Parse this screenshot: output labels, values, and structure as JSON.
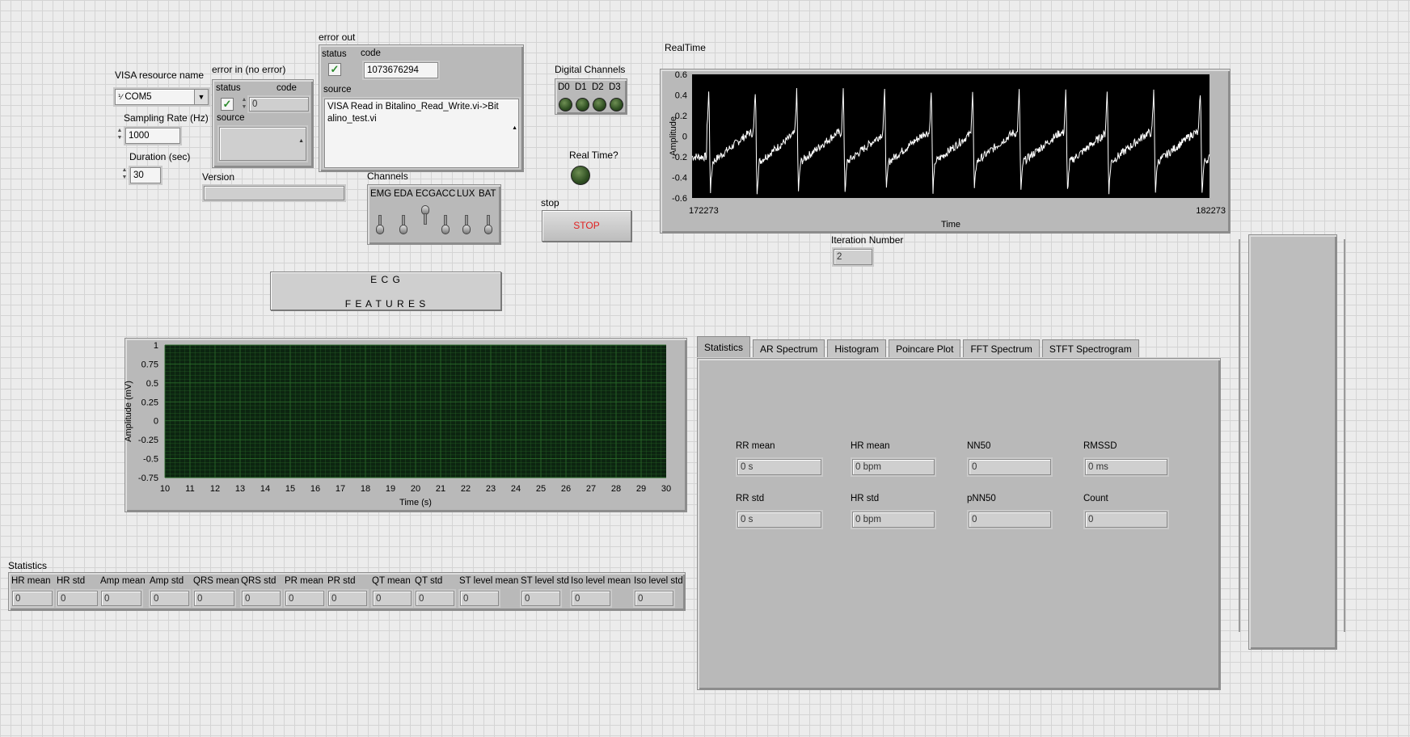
{
  "visa": {
    "label": "VISA resource name",
    "value": "COM5"
  },
  "sampling": {
    "label": "Sampling Rate (Hz)",
    "value": "1000"
  },
  "duration": {
    "label": "Duration (sec)",
    "value": "30"
  },
  "error_in": {
    "title": "error in (no error)",
    "status_label": "status",
    "code_label": "code",
    "code_value": "0",
    "source_label": "source"
  },
  "error_out": {
    "title": "error out",
    "status_label": "status",
    "code_label": "code",
    "code_value": "1073676294",
    "source_label": "source",
    "source_value": "VISA Read in Bitalino_Read_Write.vi->Bitalino_test.vi"
  },
  "version": {
    "label": "Version"
  },
  "digital": {
    "label": "Digital Channels",
    "channels": [
      "D0",
      "D1",
      "D2",
      "D3"
    ]
  },
  "realtime_toggle": {
    "label": "Real Time?"
  },
  "channels": {
    "label": "Channels",
    "names": [
      "EMG",
      "EDA",
      "ECG",
      "ACC",
      "LUX",
      "BAT"
    ]
  },
  "stop": {
    "label": "stop",
    "button": "STOP"
  },
  "ecg_features": {
    "line1": "E C G",
    "line2": "F E A T U R E S"
  },
  "iteration": {
    "label": "Iteration Number",
    "value": "2"
  },
  "realtime_graph": {
    "title": "RealTime",
    "x_start": "172273",
    "x_end": "182273",
    "xlabel": "Time",
    "ylabel": "Amplitude",
    "yticks": [
      "0.6",
      "0.4",
      "0.2",
      "0",
      "-0.2",
      "-0.4",
      "-0.6"
    ]
  },
  "ecg_graph": {
    "xlabel": "Time (s)",
    "ylabel": "Amplitude (mV)",
    "xticks": [
      "10",
      "11",
      "12",
      "13",
      "14",
      "15",
      "16",
      "17",
      "18",
      "19",
      "20",
      "21",
      "22",
      "23",
      "24",
      "25",
      "26",
      "27",
      "28",
      "29",
      "30"
    ],
    "yticks": [
      "1",
      "0.75",
      "0.5",
      "0.25",
      "0",
      "-0.25",
      "-0.5",
      "-0.75"
    ]
  },
  "tabs": [
    "Statistics",
    "AR Spectrum",
    "Histogram",
    "Poincare Plot",
    "FFT Spectrum",
    "STFT Spectrogram"
  ],
  "hrv": [
    {
      "label": "RR mean",
      "value": "0 s"
    },
    {
      "label": "HR mean",
      "value": "0 bpm"
    },
    {
      "label": "NN50",
      "value": "0"
    },
    {
      "label": "RMSSD",
      "value": "0 ms"
    },
    {
      "label": "RR std",
      "value": "0 s"
    },
    {
      "label": "HR std",
      "value": "0 bpm"
    },
    {
      "label": "pNN50",
      "value": "0"
    },
    {
      "label": "Count",
      "value": "0"
    }
  ],
  "statistics": {
    "title": "Statistics",
    "columns": [
      "HR mean",
      "HR std",
      "Amp mean",
      "Amp std",
      "QRS mean",
      "QRS std",
      "PR mean",
      "PR std",
      "QT mean",
      "QT std",
      "ST level mean",
      "ST level std",
      "Iso level mean",
      "Iso level std"
    ],
    "values": [
      "0",
      "0",
      "0",
      "0",
      "0",
      "0",
      "0",
      "0",
      "0",
      "0",
      "0",
      "0",
      "0",
      "0"
    ]
  },
  "colors": {
    "plot_bg": "#000000",
    "trace": "#ffffff",
    "ecg_bg": "#0c2410",
    "ecg_grid": "#2a6a2a",
    "stop_text": "#e02020"
  },
  "chart_data": {
    "type": "line",
    "title": "RealTime",
    "xlabel": "Time",
    "ylabel": "Amplitude",
    "xlim": [
      172273,
      182273
    ],
    "ylim": [
      -0.6,
      0.6
    ],
    "beats_x": [
      172600,
      173500,
      174300,
      175200,
      176000,
      176900,
      177700,
      178600,
      179500,
      180300,
      181200,
      182100
    ],
    "r_peak": 0.48,
    "baseline": -0.2
  }
}
